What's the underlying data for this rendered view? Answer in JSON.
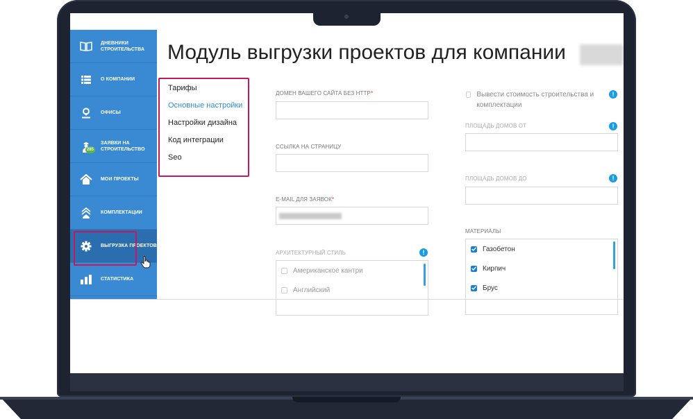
{
  "sidebar": {
    "items": [
      {
        "label": "Дневники строительства",
        "icon": "book-icon"
      },
      {
        "label": "О компании",
        "icon": "list-icon"
      },
      {
        "label": "Офисы",
        "icon": "location-pin-icon"
      },
      {
        "label": "Заявки на строительство",
        "icon": "worker-icon",
        "badge": "285"
      },
      {
        "label": "Мои проекты",
        "icon": "house-icon"
      },
      {
        "label": "Комплектации",
        "icon": "house-stack-icon"
      },
      {
        "label": "Выгрузка проектов",
        "icon": "gear-icon"
      },
      {
        "label": "Статистика",
        "icon": "bar-chart-icon"
      }
    ]
  },
  "page": {
    "title": "Модуль выгрузки проектов для компании"
  },
  "subnav": {
    "items": [
      "Тарифы",
      "Основные настройки",
      "Настройки дизайна",
      "Код интеграции",
      "Seo"
    ],
    "active": "Основные настройки"
  },
  "form": {
    "domain_label": "Домен вашего сайта без http",
    "domain_value": "",
    "page_link_label": "Ссылка на страницу",
    "page_link_value": "",
    "email_label": "E-mail для заявок",
    "style_label": "Архитектурный стиль",
    "styles": [
      {
        "label": "Американское кантри",
        "checked": false
      },
      {
        "label": "Английский",
        "checked": false
      }
    ],
    "show_cost_label": "Вывести стоимость строительства и комплектации",
    "area_from_label": "Площадь домов от",
    "area_from_value": "",
    "area_to_label": "Площадь домов до",
    "area_to_value": "",
    "materials_label": "Материалы",
    "materials": [
      {
        "label": "Газобетон",
        "checked": true
      },
      {
        "label": "Кирпич",
        "checked": true
      },
      {
        "label": "Брус",
        "checked": true
      }
    ],
    "required_mark": "*",
    "info_mark": "!"
  },
  "colors": {
    "sidebar": "#3a8ad3",
    "accent": "#1a9be6",
    "highlight": "#c3185f"
  }
}
